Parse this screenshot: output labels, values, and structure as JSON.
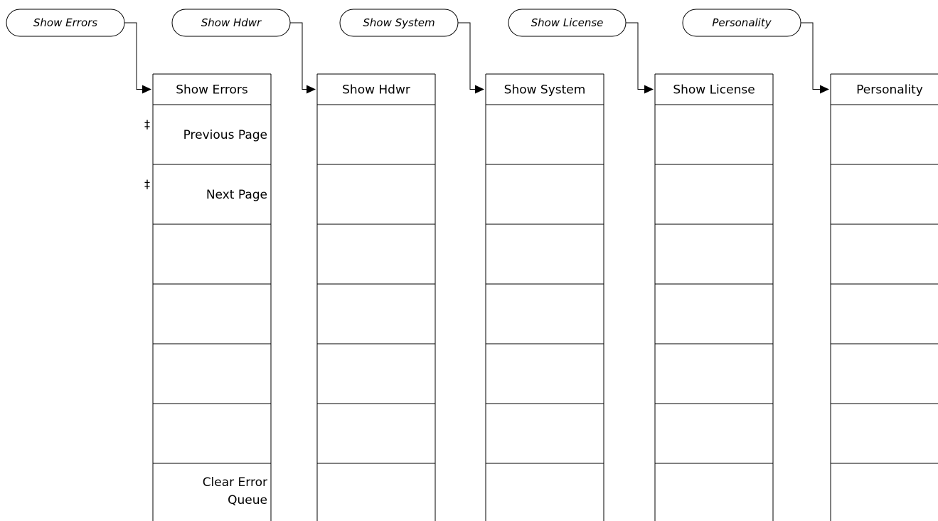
{
  "menus": [
    {
      "key": "Show Errors",
      "title": "Show Errors",
      "keys": [
        "Previous Page",
        "Next Page",
        "",
        "",
        "",
        "",
        [
          "Clear Error",
          "Queue"
        ]
      ],
      "markers": [
        "‡",
        "‡",
        "",
        "",
        "",
        "",
        ""
      ]
    },
    {
      "key": "Show Hdwr",
      "title": "Show Hdwr",
      "keys": [
        "",
        "",
        "",
        "",
        "",
        "",
        ""
      ],
      "markers": [
        "",
        "",
        "",
        "",
        "",
        "",
        ""
      ]
    },
    {
      "key": "Show System",
      "title": "Show System",
      "keys": [
        "",
        "",
        "",
        "",
        "",
        "",
        ""
      ],
      "markers": [
        "",
        "",
        "",
        "",
        "",
        "",
        ""
      ]
    },
    {
      "key": "Show License",
      "title": "Show License",
      "keys": [
        "",
        "",
        "",
        "",
        "",
        "",
        ""
      ],
      "markers": [
        "",
        "",
        "",
        "",
        "",
        "",
        ""
      ]
    },
    {
      "key": "Personality",
      "title": "Personality",
      "keys": [
        "",
        "",
        "",
        "",
        "",
        "",
        ""
      ],
      "markers": [
        "",
        "",
        "",
        "",
        "",
        "",
        ""
      ]
    }
  ]
}
